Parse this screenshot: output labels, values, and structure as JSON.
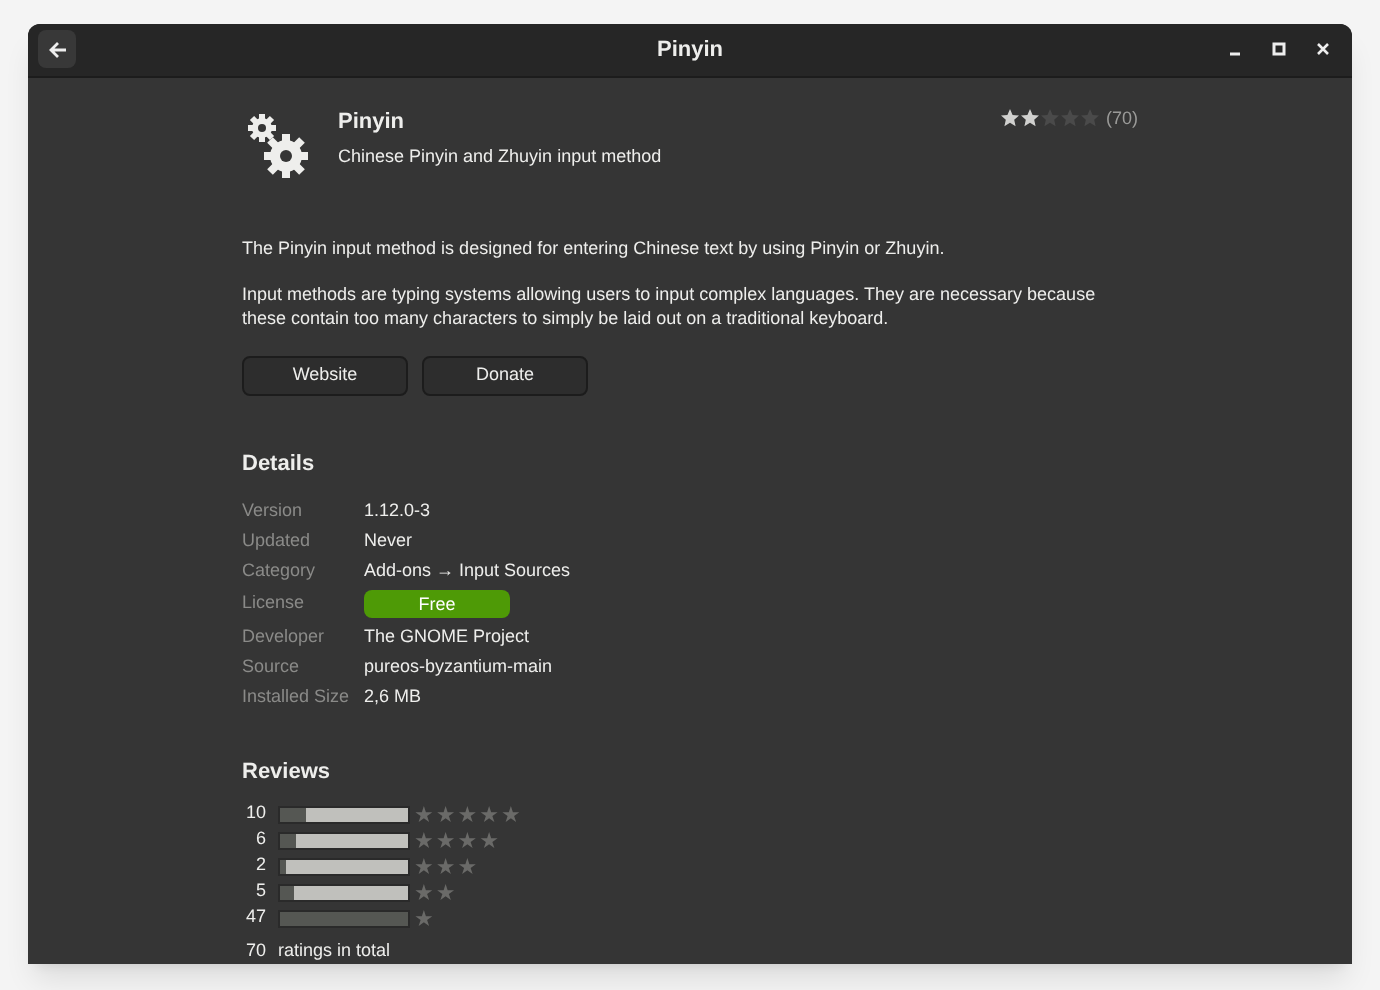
{
  "window": {
    "title": "Pinyin"
  },
  "app": {
    "name": "Pinyin",
    "summary": "Chinese Pinyin and Zhuyin input method",
    "stars": 2,
    "rating_count": "(70)"
  },
  "description": [
    "The Pinyin input method is designed for entering Chinese text by using Pinyin or Zhuyin.",
    "Input methods are typing systems allowing users to input complex languages. They are necessary because these contain too many characters to simply be laid out on a traditional keyboard."
  ],
  "buttons": [
    "Website",
    "Donate"
  ],
  "details": {
    "title": "Details",
    "rows": [
      {
        "label": "Version",
        "value": "1.12.0-3",
        "kind": "text"
      },
      {
        "label": "Updated",
        "value": "Never",
        "kind": "text"
      },
      {
        "label": "Category",
        "value": "Add-ons → Input Sources",
        "kind": "text"
      },
      {
        "label": "License",
        "value": "Free",
        "kind": "badge"
      },
      {
        "label": "Developer",
        "value": "The GNOME Project",
        "kind": "text"
      },
      {
        "label": "Source",
        "value": "pureos-byzantium-main",
        "kind": "text"
      },
      {
        "label": "Installed Size",
        "value": "2,6 MB",
        "kind": "text"
      }
    ]
  },
  "reviews": {
    "title": "Reviews",
    "rows": [
      {
        "count": "10",
        "level": 0.21,
        "star_label": "★★★★★"
      },
      {
        "count": "6",
        "level": 0.13,
        "star_label": "★★★★"
      },
      {
        "count": "2",
        "level": 0.04,
        "star_label": "★★★"
      },
      {
        "count": "5",
        "level": 0.11,
        "star_label": "★★"
      },
      {
        "count": "47",
        "level": 1,
        "star_label": "★"
      }
    ],
    "total": "70",
    "total_label": "ratings in total"
  }
}
